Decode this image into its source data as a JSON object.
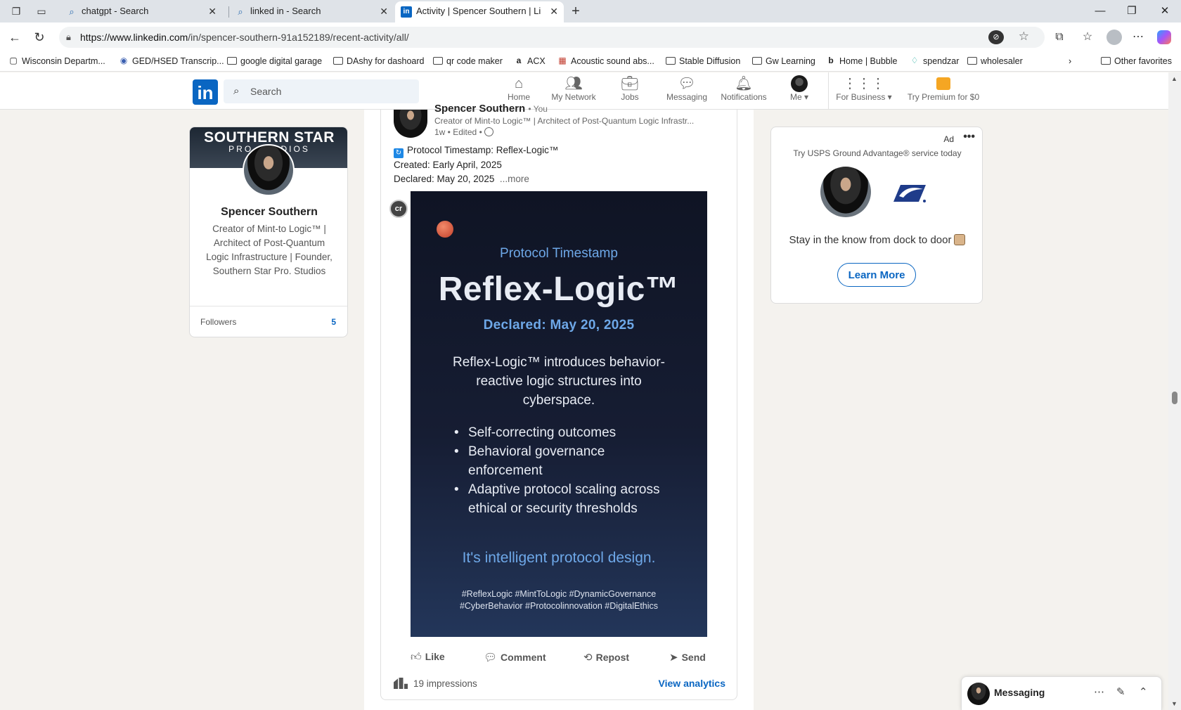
{
  "browser": {
    "tabs": [
      {
        "title": "chatgpt - Search",
        "icon": "search-icon"
      },
      {
        "title": "linked in - Search",
        "icon": "search-icon"
      },
      {
        "title": "Activity | Spencer Southern | Linke",
        "icon": "linkedin-icon"
      }
    ],
    "new_tab": "+",
    "url_host": "https://www.linkedin.com",
    "url_path": "/in/spencer-southern-91a152189/recent-activity/all/",
    "bookmarks": [
      {
        "label": "Wisconsin Departm...",
        "icon": "page-icon"
      },
      {
        "label": "GED/HSED Transcrip...",
        "icon": "site-icon"
      },
      {
        "label": "google digital garage",
        "icon": "folder-icon"
      },
      {
        "label": "DAshy for dashoard",
        "icon": "folder-icon"
      },
      {
        "label": "qr code maker",
        "icon": "folder-icon"
      },
      {
        "label": "ACX",
        "icon": "amazon-icon"
      },
      {
        "label": "Acoustic sound abs...",
        "icon": "site-icon"
      },
      {
        "label": "Stable Diffusion",
        "icon": "folder-icon"
      },
      {
        "label": "Gw Learning",
        "icon": "folder-icon"
      },
      {
        "label": "Home | Bubble",
        "icon": "bubble-icon"
      },
      {
        "label": "spendzar",
        "icon": "site-icon"
      },
      {
        "label": "wholesaler",
        "icon": "folder-icon"
      }
    ],
    "other_favorites": "Other favorites"
  },
  "linkedin": {
    "logo": "in",
    "search_placeholder": "Search",
    "nav": [
      {
        "label": "Home",
        "icon": "home-icon"
      },
      {
        "label": "My Network",
        "icon": "network-icon"
      },
      {
        "label": "Jobs",
        "icon": "briefcase-icon"
      },
      {
        "label": "Messaging",
        "icon": "chat-icon"
      },
      {
        "label": "Notifications",
        "icon": "bell-icon"
      },
      {
        "label": "Me",
        "icon": "avatar-icon"
      },
      {
        "label": "For Business",
        "icon": "grid-icon"
      },
      {
        "label": "Try Premium for $0",
        "icon": "premium-icon"
      }
    ],
    "colors": {
      "brand": "#0a66c2",
      "page_bg": "#f4f2ee"
    }
  },
  "profile_card": {
    "banner_line1": "SOUTHERN STAR",
    "banner_line2": "PRO STUDIOS",
    "name": "Spencer Southern",
    "headline": "Creator of Mint-to Logic™ | Architect of Post-Quantum Logic Infrastructure | Founder, Southern Star Pro. Studios",
    "followers_label": "Followers",
    "followers_count": "5"
  },
  "post": {
    "author": "Spencer Southern",
    "degree": "• You",
    "headline": "Creator of Mint-to Logic™ | Architect of Post-Quantum Logic Infrastr...",
    "meta": "1w • Edited •",
    "line1": "Protocol Timestamp: Reflex-Logic™",
    "line2": "Created: Early April, 2025",
    "line3": "Declared: May 20, 2025",
    "more": "...more",
    "badge": "cr",
    "image": {
      "subtitle": "Protocol Timestamp",
      "title": "Reflex-Logic™",
      "declared": "Declared: May 20, 2025",
      "intro": "Reflex-Logic™ introduces behavior-reactive logic structures into cyberspace.",
      "bullets": [
        "Self-correcting outcomes",
        "Behavioral governance enforcement",
        "Adaptive protocol scaling across ethical or security thresholds"
      ],
      "tagline": "It's intelligent protocol design.",
      "hashtags1": "#ReflexLogic  #MintToLogic  #DynamicGovernance",
      "hashtags2": "#CyberBehavior  #Protocolinnovation #DigitalEthics"
    },
    "actions": {
      "like": "Like",
      "comment": "Comment",
      "repost": "Repost",
      "send": "Send"
    },
    "impressions": "19 impressions",
    "view_analytics": "View analytics"
  },
  "ad": {
    "label": "Ad",
    "more": "•••",
    "tagline": "Try USPS Ground Advantage® service today",
    "message": "Stay in the know from dock to door",
    "cta": "Learn More"
  },
  "messaging": {
    "title": "Messaging"
  }
}
